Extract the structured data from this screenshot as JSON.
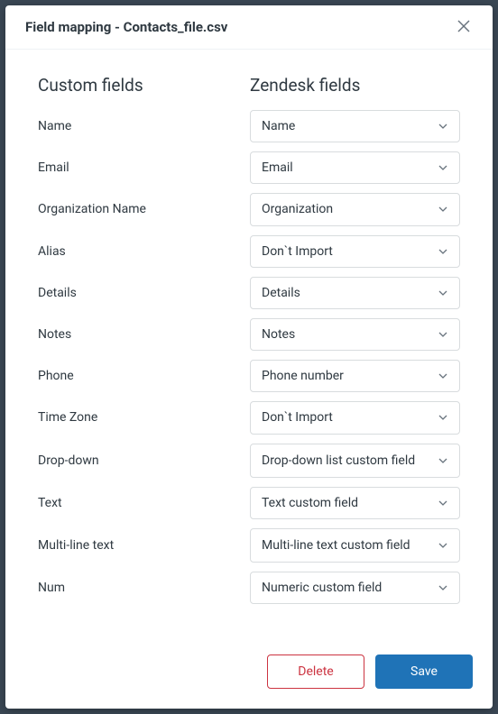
{
  "modal": {
    "title": "Field mapping - Contacts_file.csv"
  },
  "headers": {
    "custom": "Custom fields",
    "zendesk": "Zendesk fields"
  },
  "rows": [
    {
      "label": "Name",
      "value": "Name"
    },
    {
      "label": "Email",
      "value": "Email"
    },
    {
      "label": "Organization Name",
      "value": "Organization"
    },
    {
      "label": "Alias",
      "value": "Don`t Import"
    },
    {
      "label": "Details",
      "value": "Details"
    },
    {
      "label": "Notes",
      "value": "Notes"
    },
    {
      "label": "Phone",
      "value": "Phone number"
    },
    {
      "label": "Time Zone",
      "value": "Don`t Import"
    },
    {
      "label": "Drop-down",
      "value": "Drop-down list custom field"
    },
    {
      "label": "Text",
      "value": "Text custom field"
    },
    {
      "label": "Multi-line text",
      "value": "Multi-line text custom field"
    },
    {
      "label": "Num",
      "value": "Numeric custom field"
    }
  ],
  "footer": {
    "delete": "Delete",
    "save": "Save"
  }
}
